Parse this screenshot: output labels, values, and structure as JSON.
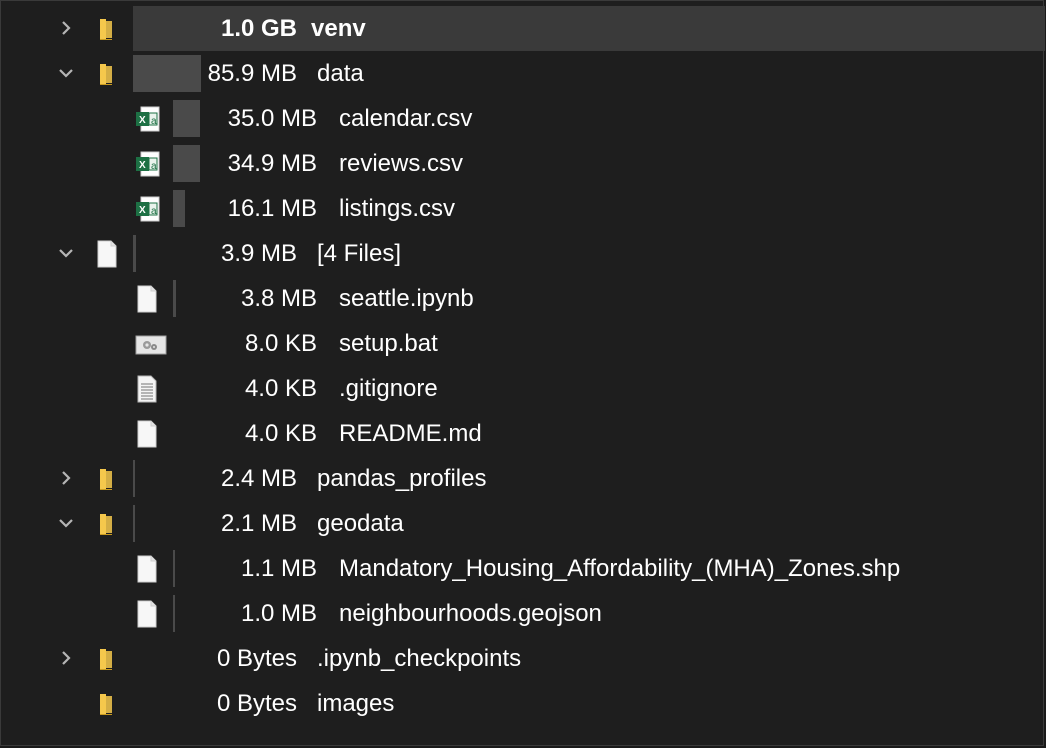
{
  "rows": [
    {
      "level": 0,
      "expander": "collapsed",
      "icon": "folder-icon",
      "size": "1.0 GB",
      "name": "venv",
      "bold": true,
      "selected": true,
      "bar_fraction": 1.0
    },
    {
      "level": 0,
      "expander": "expanded",
      "icon": "folder-icon",
      "size": "85.9 MB",
      "name": "data",
      "bar_fraction": 0.085
    },
    {
      "level": 1,
      "expander": "none",
      "icon": "excel-file-icon",
      "size": "35.0 MB",
      "name": "calendar.csv",
      "bar_fraction": 0.035
    },
    {
      "level": 1,
      "expander": "none",
      "icon": "excel-file-icon",
      "size": "34.9 MB",
      "name": "reviews.csv",
      "bar_fraction": 0.035
    },
    {
      "level": 1,
      "expander": "none",
      "icon": "excel-file-icon",
      "size": "16.1 MB",
      "name": "listings.csv",
      "bar_fraction": 0.016
    },
    {
      "level": 0,
      "expander": "expanded",
      "icon": "file-icon",
      "size": "3.9 MB",
      "name": "[4 Files]",
      "bar_fraction": 0.004
    },
    {
      "level": 1,
      "expander": "none",
      "icon": "file-icon",
      "size": "3.8 MB",
      "name": "seattle.ipynb",
      "bar_fraction": 0.004
    },
    {
      "level": 1,
      "expander": "none",
      "icon": "batch-file-icon",
      "size": "8.0 KB",
      "name": "setup.bat",
      "bar_fraction": 0.0
    },
    {
      "level": 1,
      "expander": "none",
      "icon": "text-file-icon",
      "size": "4.0 KB",
      "name": ".gitignore",
      "bar_fraction": 0.0
    },
    {
      "level": 1,
      "expander": "none",
      "icon": "file-icon",
      "size": "4.0 KB",
      "name": "README.md",
      "bar_fraction": 0.0
    },
    {
      "level": 0,
      "expander": "collapsed",
      "icon": "folder-icon",
      "size": "2.4 MB",
      "name": "pandas_profiles",
      "bar_fraction": 0.002
    },
    {
      "level": 0,
      "expander": "expanded",
      "icon": "folder-icon",
      "size": "2.1 MB",
      "name": "geodata",
      "bar_fraction": 0.002
    },
    {
      "level": 1,
      "expander": "none",
      "icon": "file-icon",
      "size": "1.1 MB",
      "name": "Mandatory_Housing_Affordability_(MHA)_Zones.shp",
      "bar_fraction": 0.001
    },
    {
      "level": 1,
      "expander": "none",
      "icon": "file-icon",
      "size": "1.0 MB",
      "name": "neighbourhoods.geojson",
      "bar_fraction": 0.001
    },
    {
      "level": 0,
      "expander": "collapsed",
      "icon": "folder-icon",
      "size": "0 Bytes",
      "name": ".ipynb_checkpoints",
      "bar_fraction": 0.0
    },
    {
      "level": 0,
      "expander": "none",
      "icon": "folder-icon",
      "size": "0 Bytes",
      "name": "images",
      "bar_fraction": 0.0
    }
  ],
  "colors": {
    "background": "#1e1e1e",
    "selected_row": "#3a3a3a",
    "size_bar": "#4a4a4a",
    "folder": "#f5c84c",
    "excel": "#1d7044",
    "text": "#ffffff"
  }
}
